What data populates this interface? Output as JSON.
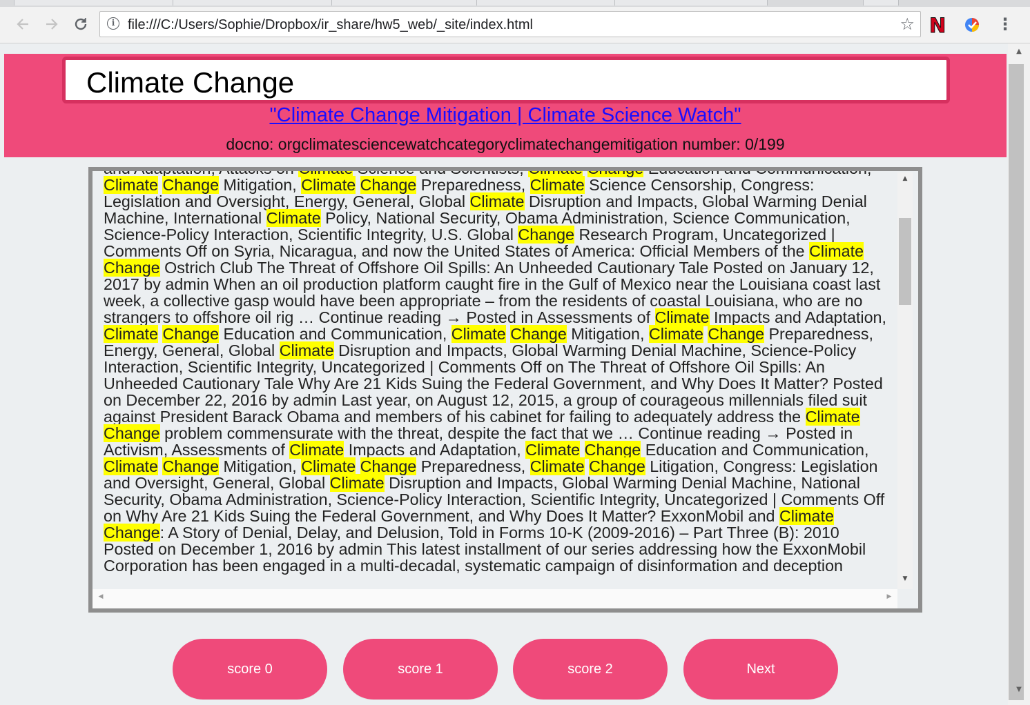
{
  "browser": {
    "url": "file:///C:/Users/Sophie/Dropbox/ir_share/hw5_web/_site/index.html",
    "extension_n_label": "N"
  },
  "header": {
    "query": "Climate Change",
    "doc_title": "\"Climate Change Mitigation | Climate Science Watch\"",
    "doc_meta": "docno: orgclimatesciencewatchcategoryclimatechangemitigation number: 0/199"
  },
  "document": {
    "highlight_terms": [
      "Climate",
      "Change"
    ],
    "text": "and Adaptation, Attacks on Climate Science and Scientists, Climate Change Education and Communication, Climate Change Mitigation, Climate Change Preparedness, Climate Science Censorship, Congress: Legislation and Oversight, Energy, General, Global Climate Disruption and Impacts, Global Warming Denial Machine, International Climate Policy, National Security, Obama Administration, Science Communication, Science-Policy Interaction, Scientific Integrity, U.S. Global Change Research Program, Uncategorized | Comments Off on Syria, Nicaragua, and now the United States of America:  Official Members of the Climate Change Ostrich Club The Threat of Offshore Oil Spills: An Unheeded Cautionary Tale Posted on January 12, 2017 by admin When an oil production platform caught fire in the Gulf of Mexico near the Louisiana coast last week, a collective gasp would have been appropriate – from the residents of coastal Louisiana, who are no strangers to offshore oil rig … Continue reading → Posted in Assessments of Climate Impacts and Adaptation, Climate Change Education and Communication, Climate Change Mitigation, Climate Change Preparedness, Energy, General, Global Climate Disruption and Impacts, Global Warming Denial Machine, Science-Policy Interaction, Scientific Integrity, Uncategorized | Comments Off on The Threat of Offshore Oil Spills: An Unheeded Cautionary Tale Why Are 21 Kids Suing the Federal Government, and Why Does It Matter? Posted on December 22, 2016 by admin Last year, on August 12, 2015, a group of courageous millennials filed suit against President Barack Obama and members of his cabinet for failing to adequately address the Climate Change problem commensurate with the threat, despite the fact that we … Continue reading → Posted in Activism, Assessments of Climate Impacts and Adaptation, Climate Change Education and Communication, Climate Change Mitigation, Climate Change Preparedness, Climate Change Litigation, Congress: Legislation and Oversight, General, Global Climate Disruption and Impacts, Global Warming Denial Machine, National Security, Obama Administration, Science-Policy Interaction, Scientific Integrity, Uncategorized | Comments Off on Why Are 21 Kids Suing the Federal Government, and Why Does It Matter? ExxonMobil and Climate Change: A Story of Denial, Delay, and Delusion, Told in Forms 10-K (2009-2016) – Part Three (B): 2010 Posted on December 1, 2016 by admin This latest installment of our series addressing how the ExxonMobil Corporation has been engaged in a multi-decadal, systematic campaign of disinformation and deception"
  },
  "buttons": {
    "score0": "score 0",
    "score1": "score 1",
    "score2": "score 2",
    "next": "Next"
  },
  "colors": {
    "accent": "#ef4a7a",
    "highlight": "#ffff00",
    "link": "#1a0dff"
  },
  "icons": {
    "back": "back-arrow-icon",
    "forward": "forward-arrow-icon",
    "reload": "reload-icon",
    "info": "info-icon",
    "star": "star-icon",
    "menu": "more-vert-icon"
  }
}
